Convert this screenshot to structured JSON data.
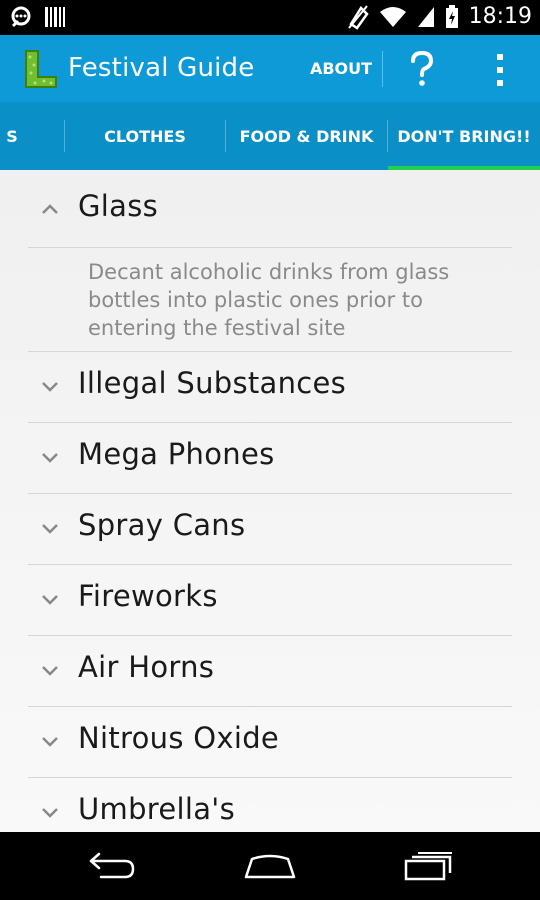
{
  "status_bar": {
    "time": "18:19",
    "left_icons": [
      "notification-chat-icon",
      "notification-barcode-icon"
    ],
    "right_icons": [
      "no-signal-icon",
      "wifi-icon",
      "cellular-signal-icon",
      "battery-charging-icon"
    ]
  },
  "action_bar": {
    "title": "Festival Guide",
    "about_label": "ABOUT",
    "help_icon": "question-mark-icon",
    "overflow_icon": "overflow-menu-icon",
    "colors": {
      "bar": "#0e9ad6",
      "tabs": "#0a8fc6",
      "indicator": "#21d04f"
    }
  },
  "tabs": [
    {
      "label": "S",
      "selected": false
    },
    {
      "label": "CLOTHES",
      "selected": false
    },
    {
      "label": "FOOD & DRINK",
      "selected": false
    },
    {
      "label": "DON'T BRING!!",
      "selected": true
    }
  ],
  "list": {
    "groups": [
      {
        "label": "Glass",
        "expanded": true,
        "detail": "Decant alcoholic drinks from glass bottles into plastic ones prior to entering the festival site"
      },
      {
        "label": "Illegal Substances",
        "expanded": false
      },
      {
        "label": "Mega Phones",
        "expanded": false
      },
      {
        "label": "Spray Cans",
        "expanded": false
      },
      {
        "label": "Fireworks",
        "expanded": false
      },
      {
        "label": "Air Horns",
        "expanded": false
      },
      {
        "label": "Nitrous Oxide",
        "expanded": false
      },
      {
        "label": "Umbrella's",
        "expanded": false
      }
    ]
  },
  "nav_bar": {
    "buttons": [
      "back-icon",
      "home-icon",
      "recent-apps-icon"
    ]
  }
}
